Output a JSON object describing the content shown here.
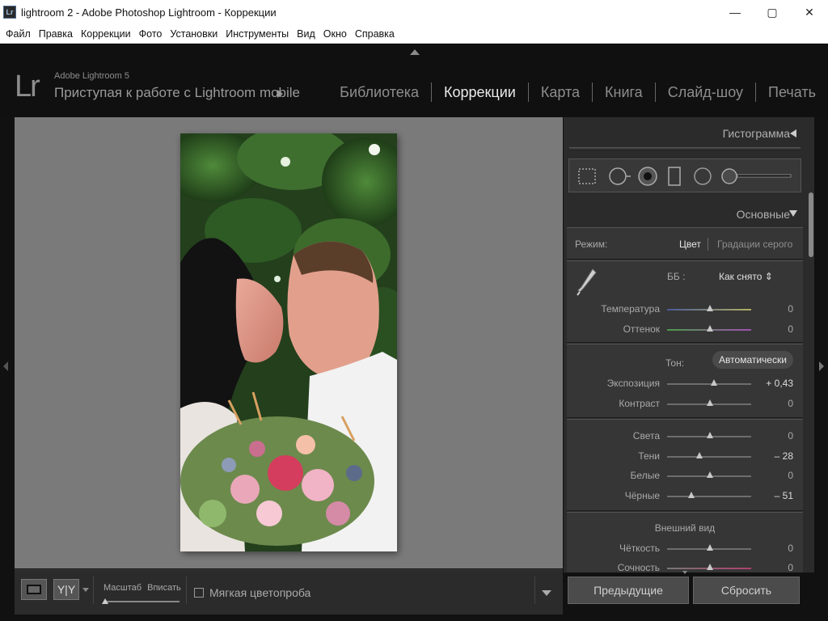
{
  "window": {
    "title": "lightroom 2 - Adobe Photoshop Lightroom - Коррекции",
    "app_icon_text": "Lr",
    "controls": [
      "—",
      "▢",
      "✕"
    ]
  },
  "menubar": [
    "Файл",
    "Правка",
    "Коррекции",
    "Фото",
    "Установки",
    "Инструменты",
    "Вид",
    "Окно",
    "Справка"
  ],
  "identity": {
    "logo": "Lr",
    "version": "Adobe Lightroom 5",
    "text": "Приступая к работе с Lightroom mobile"
  },
  "modules": [
    {
      "label": "Библиотека",
      "active": false
    },
    {
      "label": "Коррекции",
      "active": true
    },
    {
      "label": "Карта",
      "active": false
    },
    {
      "label": "Книга",
      "active": false
    },
    {
      "label": "Слайд-шоу",
      "active": false
    },
    {
      "label": "Печать",
      "active": false
    }
  ],
  "toolbar": {
    "view_yy": "Y|Y",
    "scale_label": "Масштаб",
    "scale_value": "Вписать",
    "soft_proof_label": "Мягкая цветопроба",
    "soft_proof_checked": false
  },
  "right_panel": {
    "histogram_header": "Гистограмма",
    "basic_header": "Основные",
    "mode": {
      "label": "Режим:",
      "options": [
        "Цвет",
        "Градации серого"
      ],
      "selected": "Цвет"
    },
    "wb": {
      "label": "ББ :",
      "value": "Как снято ⇕"
    },
    "sliders_wb": [
      {
        "label": "Температура",
        "value": "0",
        "position": 0.5,
        "track": "temp"
      },
      {
        "label": "Оттенок",
        "value": "0",
        "position": 0.5,
        "track": "tint"
      }
    ],
    "tone": {
      "label": "Тон:",
      "auto_button": "Автоматически"
    },
    "sliders_tone1": [
      {
        "label": "Экспозиция",
        "value": "+ 0,43",
        "position": 0.55,
        "bright": true
      },
      {
        "label": "Контраст",
        "value": "0",
        "position": 0.5,
        "bright": false
      }
    ],
    "sliders_tone2": [
      {
        "label": "Света",
        "value": "0",
        "position": 0.5,
        "bright": false
      },
      {
        "label": "Тени",
        "value": "– 28",
        "position": 0.38,
        "bright": true
      },
      {
        "label": "Белые",
        "value": "0",
        "position": 0.5,
        "bright": false
      },
      {
        "label": "Чёрные",
        "value": "– 51",
        "position": 0.26,
        "bright": true
      }
    ],
    "presence": {
      "label": "Внешний вид",
      "sliders": [
        {
          "label": "Чёткость",
          "value": "0",
          "position": 0.5
        },
        {
          "label": "Сочность",
          "value": "0",
          "position": 0.5
        }
      ]
    }
  },
  "bottom_buttons": {
    "previous": "Предыдущие",
    "reset": "Сбросить"
  },
  "colors": {
    "canvas_bg": "#7a7a7a",
    "panel_bg": "#2b2b2b",
    "active_module": "#eaeaea"
  }
}
